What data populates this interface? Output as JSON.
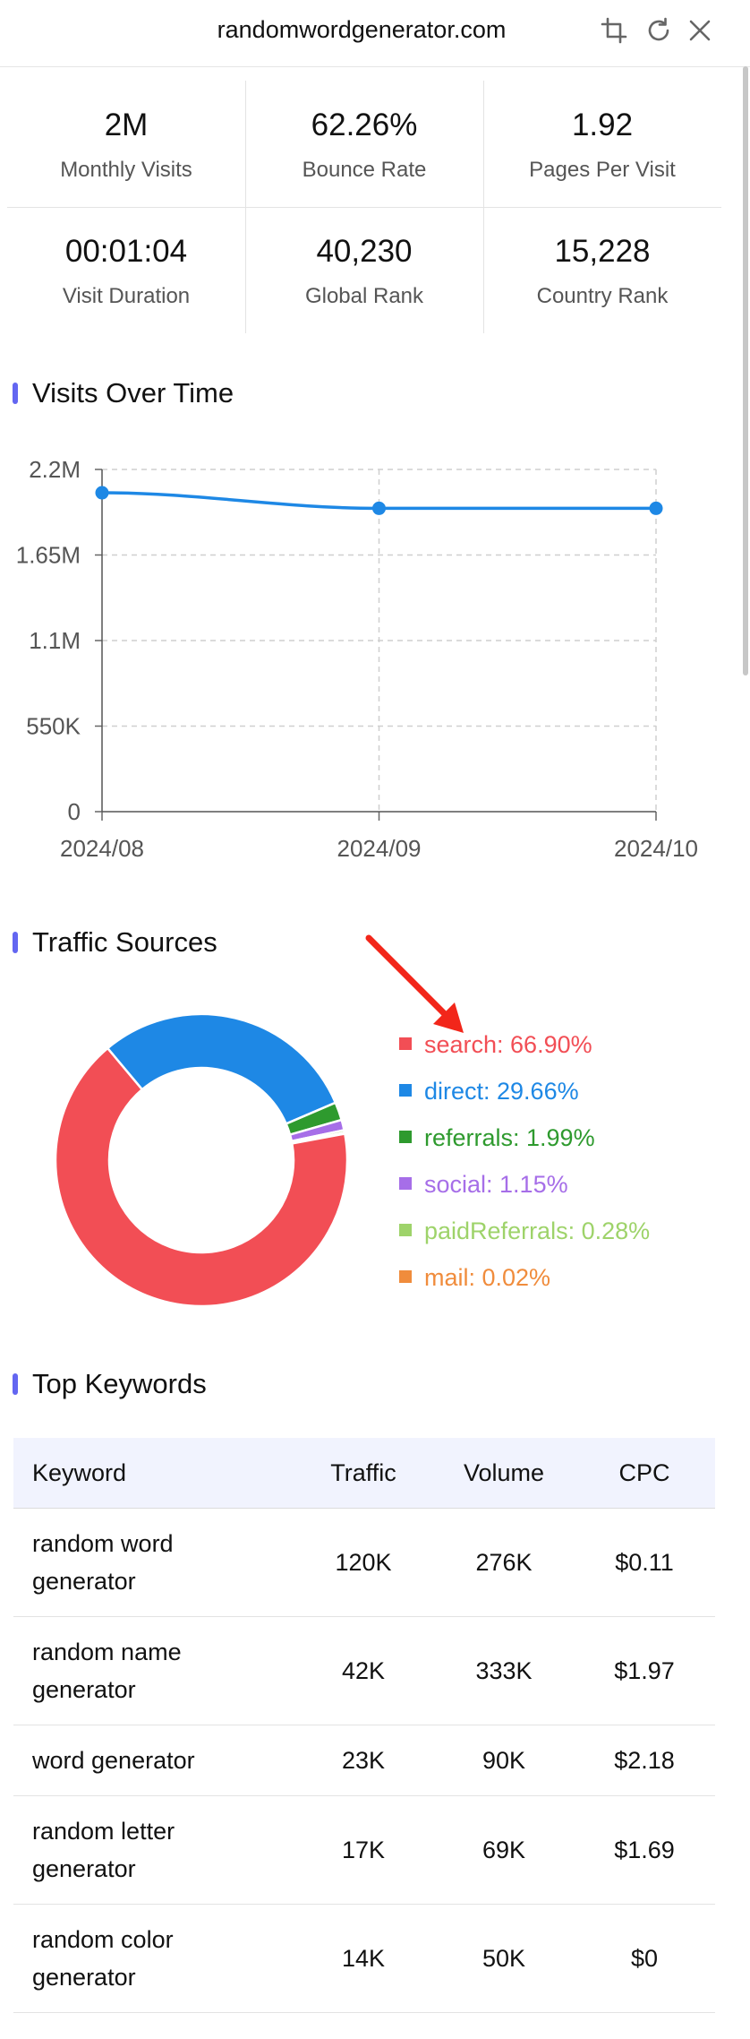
{
  "header": {
    "title": "randomwordgenerator.com"
  },
  "stats": [
    {
      "value": "2M",
      "label": "Monthly Visits"
    },
    {
      "value": "62.26%",
      "label": "Bounce Rate"
    },
    {
      "value": "1.92",
      "label": "Pages Per Visit"
    },
    {
      "value": "00:01:04",
      "label": "Visit Duration"
    },
    {
      "value": "40,230",
      "label": "Global Rank"
    },
    {
      "value": "15,228",
      "label": "Country Rank"
    }
  ],
  "visits": {
    "title": "Visits Over Time"
  },
  "traffic": {
    "title": "Traffic Sources",
    "legend": [
      {
        "label": "search: 66.90%",
        "color": "#f24e55"
      },
      {
        "label": "direct: 29.66%",
        "color": "#1e88e5"
      },
      {
        "label": "referrals: 1.99%",
        "color": "#2e9a2e"
      },
      {
        "label": "social: 1.15%",
        "color": "#a66ee8"
      },
      {
        "label": "paidReferrals: 0.28%",
        "color": "#9ed36a"
      },
      {
        "label": "mail: 0.02%",
        "color": "#f08c3c"
      }
    ]
  },
  "keywords": {
    "title": "Top Keywords",
    "columns": [
      "Keyword",
      "Traffic",
      "Volume",
      "CPC"
    ],
    "rows": [
      {
        "keyword": "random word generator",
        "traffic": "120K",
        "volume": "276K",
        "cpc": "$0.11"
      },
      {
        "keyword": "random name generator",
        "traffic": "42K",
        "volume": "333K",
        "cpc": "$1.97"
      },
      {
        "keyword": "word generator",
        "traffic": "23K",
        "volume": "90K",
        "cpc": "$2.18"
      },
      {
        "keyword": "random letter generator",
        "traffic": "17K",
        "volume": "69K",
        "cpc": "$1.69"
      },
      {
        "keyword": "random color generator",
        "traffic": "14K",
        "volume": "50K",
        "cpc": "$0"
      }
    ]
  },
  "chart_data": [
    {
      "type": "line",
      "x": [
        "2024/08",
        "2024/09",
        "2024/10"
      ],
      "series": [
        {
          "values": [
            2050000,
            1950000,
            1950000
          ]
        }
      ],
      "ylim": [
        0,
        2200000
      ],
      "yticks": [
        0,
        550000,
        1100000,
        1650000,
        2200000
      ],
      "ytick_labels": [
        "0",
        "550K",
        "1.1M",
        "1.65M",
        "2.2M"
      ],
      "grid": true,
      "color": "#1e88e5"
    },
    {
      "type": "pie",
      "categories": [
        "search",
        "direct",
        "referrals",
        "social",
        "paidReferrals",
        "mail"
      ],
      "values": [
        66.9,
        29.66,
        1.99,
        1.15,
        0.28,
        0.02
      ],
      "colors": [
        "#f24e55",
        "#1e88e5",
        "#2e9a2e",
        "#a66ee8",
        "#9ed36a",
        "#f08c3c"
      ]
    }
  ]
}
